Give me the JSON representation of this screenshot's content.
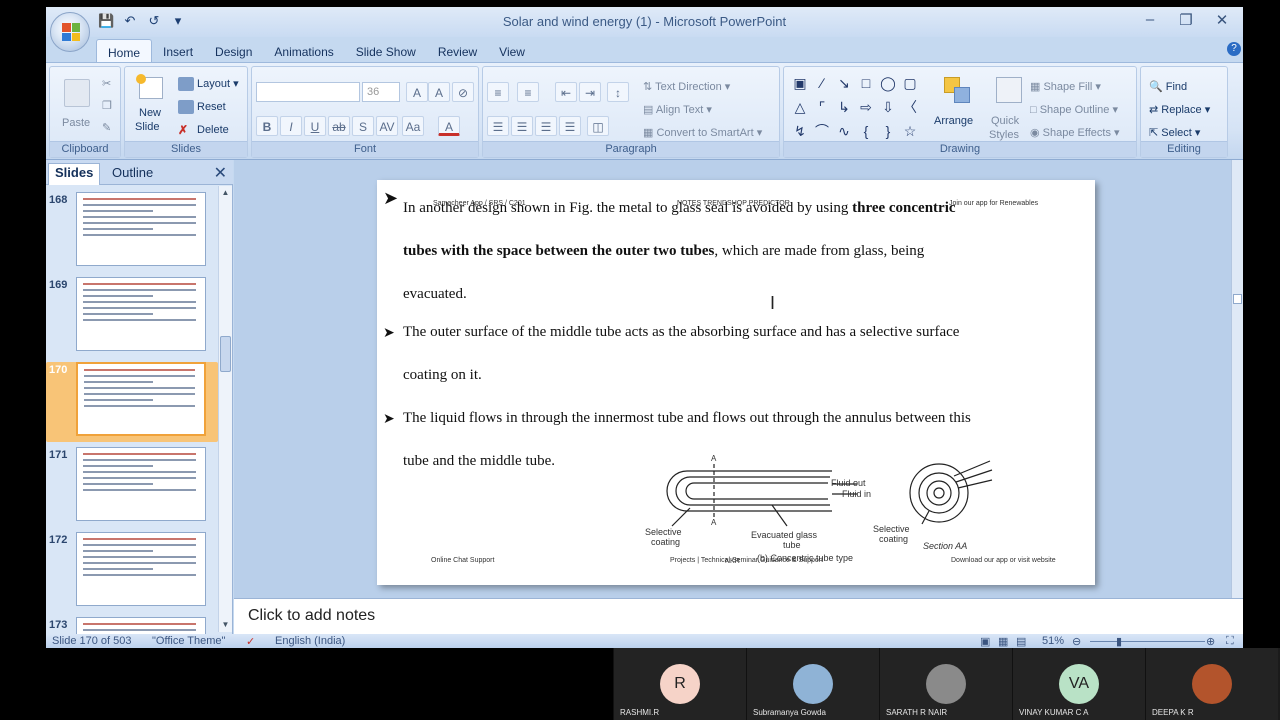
{
  "window": {
    "title": "Solar and wind energy (1) - Microsoft PowerPoint"
  },
  "ribbon_tabs": [
    "Home",
    "Insert",
    "Design",
    "Animations",
    "Slide Show",
    "Review",
    "View"
  ],
  "ribbon": {
    "clipboard": {
      "label": "Clipboard",
      "paste": "Paste"
    },
    "slides": {
      "label": "Slides",
      "new_slide_1": "New",
      "new_slide_2": "Slide",
      "layout": "Layout",
      "reset": "Reset",
      "delete": "Delete"
    },
    "font": {
      "label": "Font",
      "size": "36"
    },
    "paragraph": {
      "label": "Paragraph",
      "text_direction": "Text Direction",
      "align_text": "Align Text",
      "convert_smartart": "Convert to SmartArt"
    },
    "drawing": {
      "label": "Drawing",
      "arrange": "Arrange",
      "quick_styles_1": "Quick",
      "quick_styles_2": "Styles",
      "shape_fill": "Shape Fill",
      "shape_outline": "Shape Outline",
      "shape_effects": "Shape Effects"
    },
    "editing": {
      "label": "Editing",
      "find": "Find",
      "replace": "Replace",
      "select": "Select"
    }
  },
  "left_pane": {
    "tab_slides": "Slides",
    "tab_outline": "Outline",
    "thumbnails": [
      {
        "num": "168"
      },
      {
        "num": "169"
      },
      {
        "num": "170",
        "selected": true
      },
      {
        "num": "171"
      },
      {
        "num": "172"
      },
      {
        "num": "173"
      }
    ]
  },
  "slide": {
    "p1_a": "In another design shown in Fig. the metal to glass seal is avoided by using ",
    "p1_bold1": "three concentric",
    "p1_bold2": "tubes with the space between the outer two tubes",
    "p1_b": ", which are made from glass, being",
    "p1_c": "evacuated.",
    "p2_a": "The outer surface of the middle tube acts as the absorbing surface and has a selective surface",
    "p2_b": "coating on it.",
    "p3_a": "The liquid flows in through the innermost tube and flows out through the annulus between this",
    "p3_b": "tube and the middle tube.",
    "faint_header_left": "Samacheer App / SRS / C201",
    "faint_header_mid": "NOTES  TRENDSHOP  PREDICTOR",
    "faint_header_right": "Join our app for Renewables",
    "footer_left": "Online Chat Support",
    "footer_mid": "Projects | Technical Seminar Guidance & Support",
    "footer_right": "Download our app or visit website",
    "footer_tag": "NKR",
    "figure": {
      "label_a_top": "A",
      "label_a_bottom": "A",
      "fluid_out": "Fluid out",
      "fluid_in": "Fluid in",
      "selective_coating_1": "Selective",
      "selective_coating_2": "coating",
      "evacuated_1": "Evacuated glass",
      "evacuated_2": "tube",
      "selective_coating_3": "Selective",
      "selective_coating_4": "coating",
      "section": "Section AA",
      "caption": "(b) Concentric tube type"
    }
  },
  "notes": {
    "placeholder": "Click to add notes"
  },
  "status": {
    "slide_count": "Slide 170 of 503",
    "theme": "\"Office Theme\"",
    "language": "English (India)",
    "zoom": "51%"
  },
  "participants": [
    {
      "name": "RASHMI.R",
      "initial": "R",
      "bg": "#f6d3c8"
    },
    {
      "name": "Subramanya Gowda",
      "initial": "",
      "bg": "#8fb3d6"
    },
    {
      "name": "SARATH R NAIR",
      "initial": "",
      "bg": "#8a8a8a"
    },
    {
      "name": "VINAY KUMAR C A",
      "initial": "VA",
      "bg": "#b9e2c6"
    },
    {
      "name": "DEEPA K R",
      "initial": "",
      "bg": "#b3542c"
    }
  ]
}
